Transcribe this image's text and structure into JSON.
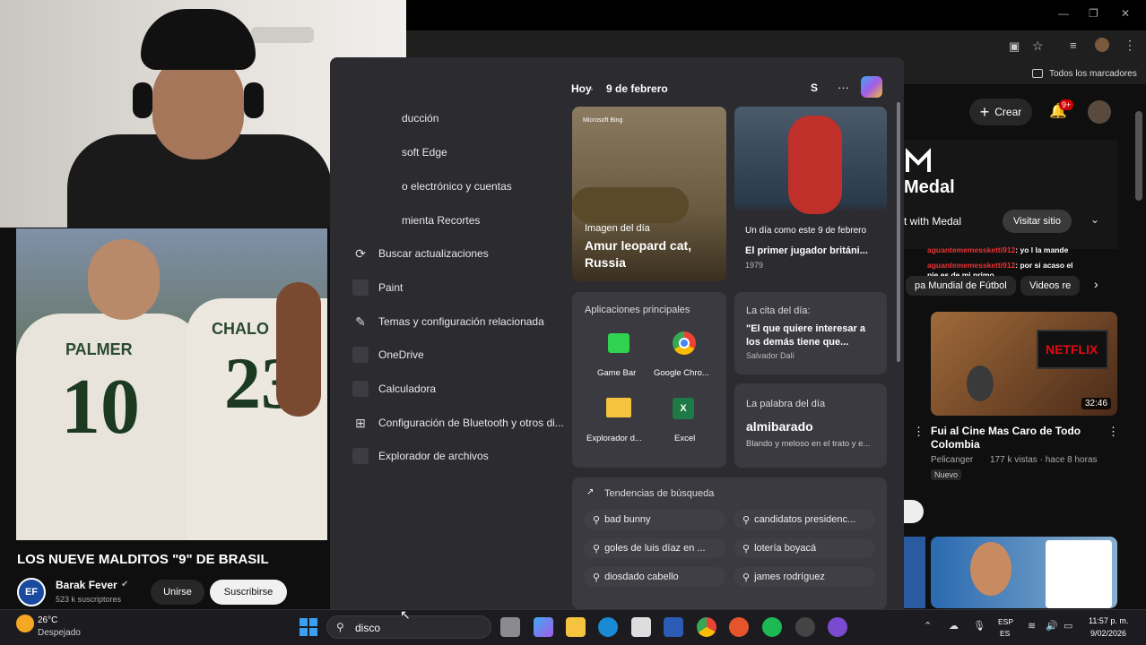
{
  "bookmarks": {
    "all_label": "Todos los marcadores"
  },
  "youtube": {
    "create_label": "Crear",
    "notif_badge": "9+",
    "ad_brand": "Medal",
    "ad_text": "t with Medal",
    "visit_label": "Visitar sitio",
    "chat": [
      {
        "user": "aguantememessketti912",
        "msg": ": yo l la mande"
      },
      {
        "user": "aguantememessketti912",
        "msg": ": por si acaso el"
      },
      {
        "user": "",
        "msg": "pie es de mi primo"
      }
    ],
    "chips": [
      "pa Mundial de Fútbol",
      "Videos re"
    ],
    "video1": {
      "title": "Fui al Cine Mas Caro de Todo Colombia",
      "channel": "Pelicanger",
      "meta": "177 k vistas · hace 8 horas",
      "badge": "Nuevo",
      "duration": "32:46",
      "thumb_text": "NETFLIX"
    },
    "main": {
      "title": "LOS NUEVE MALDITOS \"9\" DE BRASIL",
      "channel": "Barak Fever",
      "subs": "523 k suscriptores",
      "join": "Unirse",
      "subscribe": "Suscribirse",
      "jersey_name1": "PALMER",
      "jersey_num1": "10",
      "jersey_name2": "CHALO",
      "jersey_num2": "23",
      "avatar": "EF"
    }
  },
  "menu": {
    "items": [
      "ducción",
      "soft Edge",
      "o electrónico y cuentas",
      "mienta Recortes",
      "Buscar actualizaciones",
      "Paint",
      "Temas y configuración relacionada",
      "OneDrive",
      "Calculadora",
      "Configuración de Bluetooth y otros di...",
      "Explorador de archivos"
    ],
    "date_label": "Hoy",
    "date_value": "9 de febrero",
    "user_initial": "S",
    "more": "···",
    "image_of_day": {
      "brand": "Microsoft Bing",
      "label": "Imagen del día",
      "title": "Amur leopard cat, Russia"
    },
    "on_this_day": {
      "label": "Un día como este 9 de febrero",
      "title": "El primer jugador británi...",
      "year": "1979"
    },
    "top_apps": {
      "label": "Aplicaciones principales",
      "apps": [
        "Game Bar",
        "Google Chro...",
        "Explorador d...",
        "Excel"
      ]
    },
    "quote": {
      "label": "La cita del día:",
      "text": "\"El que quiere interesar a los demás tiene que...",
      "author": "Salvador Dalí"
    },
    "word": {
      "label": "La palabra del día",
      "word": "almibarado",
      "def": "Blando y meloso en el trato y e..."
    },
    "trends": {
      "label": "Tendencias de búsqueda",
      "items": [
        "bad bunny",
        "candidatos presidenc...",
        "goles de luis díaz en ...",
        "lotería boyacá",
        "diosdado cabello",
        "james rodríguez"
      ]
    }
  },
  "taskbar": {
    "weather_temp": "26°C",
    "weather_desc": "Despejado",
    "search_value": "disco",
    "lang1": "ESP",
    "lang2": "ES",
    "time": "11:57 p. m.",
    "date": "9/02/2026"
  },
  "colors": {
    "accent_red": "#cc0000",
    "menu_bg": "#2b2b30",
    "taskbar_bg": "#1c1c20"
  }
}
